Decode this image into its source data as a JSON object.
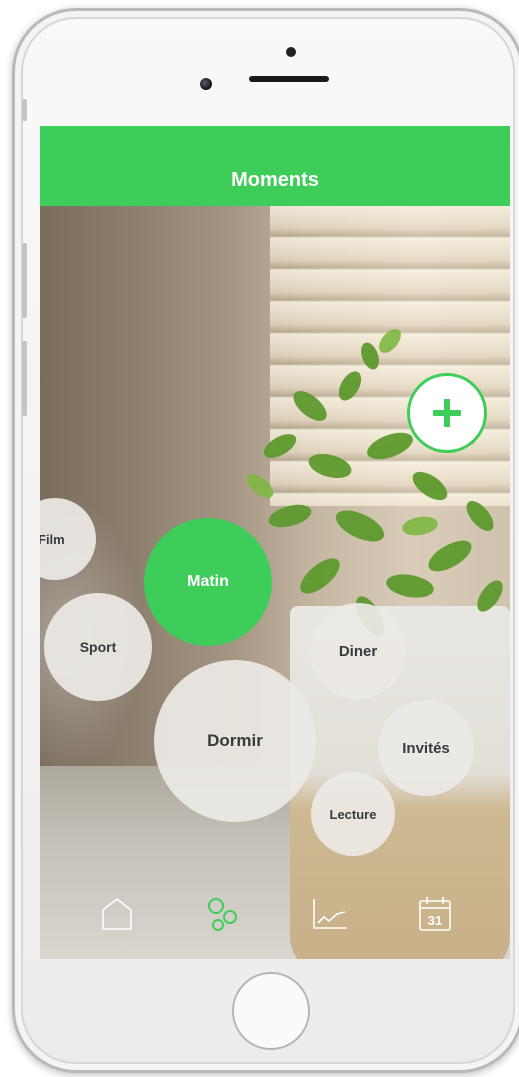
{
  "header": {
    "title": "Moments"
  },
  "colors": {
    "accent": "#3fcd5a",
    "bubble": "#ecEae5",
    "text": "#3a3a3a"
  },
  "moments": [
    {
      "label": "Film",
      "active": false
    },
    {
      "label": "Matin",
      "active": true
    },
    {
      "label": "Sport",
      "active": false
    },
    {
      "label": "Diner",
      "active": false
    },
    {
      "label": "Dormir",
      "active": false
    },
    {
      "label": "Invités",
      "active": false
    },
    {
      "label": "Lecture",
      "active": false
    }
  ],
  "add_button": {
    "icon": "plus-icon"
  },
  "tabbar": {
    "tabs": [
      {
        "icon": "home-icon",
        "active": false
      },
      {
        "icon": "moments-icon",
        "active": true
      },
      {
        "icon": "chart-icon",
        "active": false
      },
      {
        "icon": "calendar-icon",
        "active": false,
        "calendar_day": "31"
      }
    ]
  }
}
